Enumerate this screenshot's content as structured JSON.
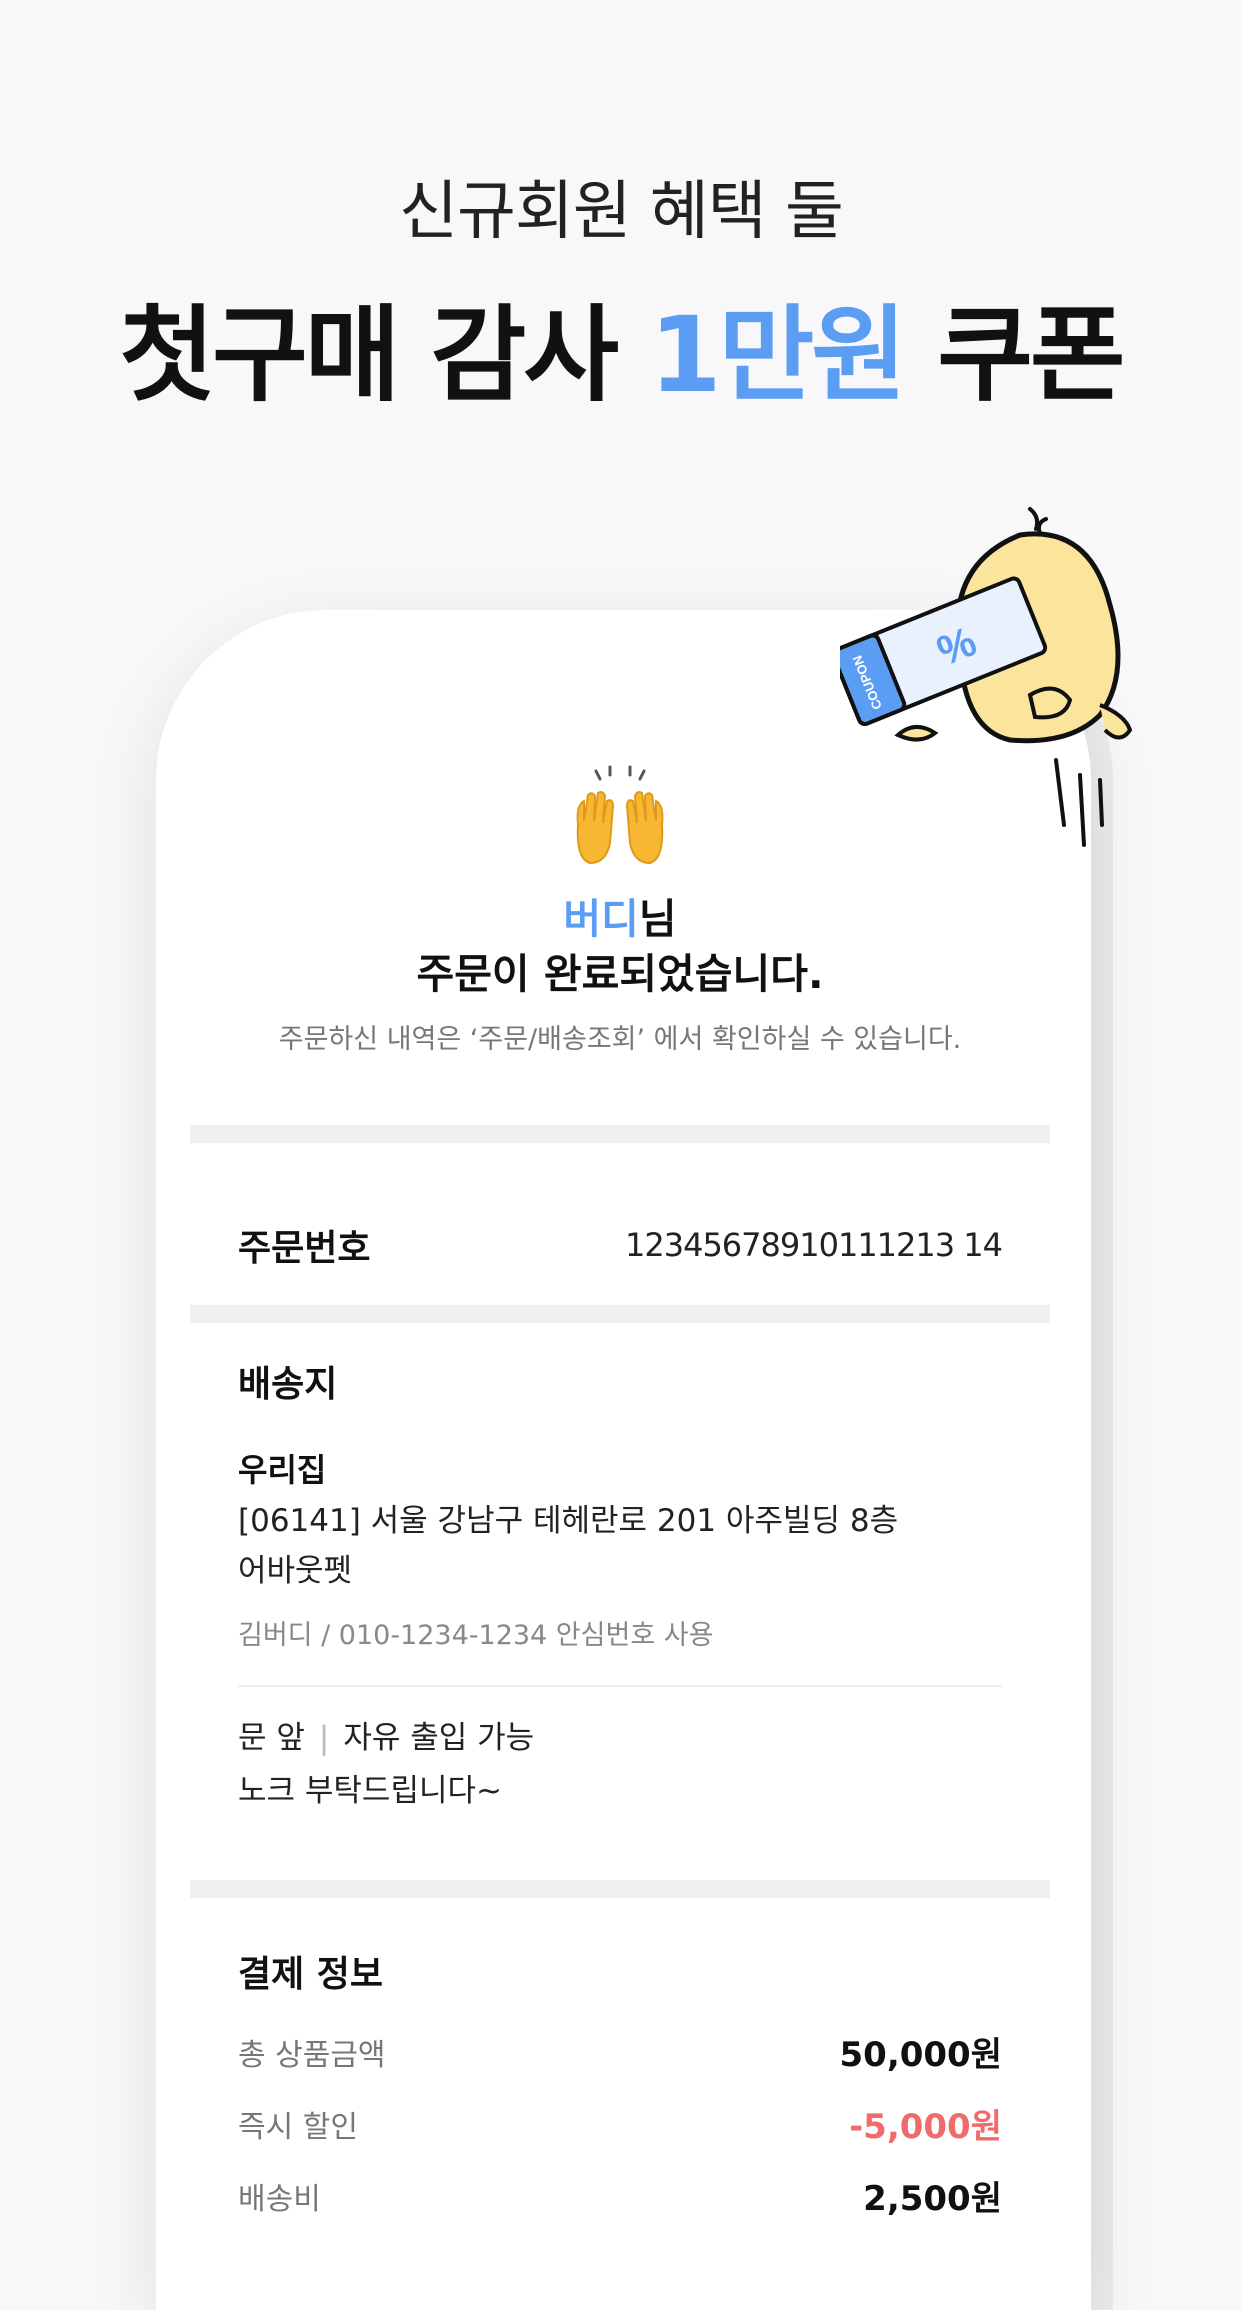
{
  "headline": {
    "sub": "신규회원 혜택 둘",
    "main_prefix": "첫구매 감사 ",
    "main_accent": "1만원",
    "main_suffix": " 쿠폰"
  },
  "colors": {
    "accent": "#5b9df2",
    "discount": "#f06b6b"
  },
  "mascot": {
    "coupon_text": "COUPON",
    "coupon_symbol": "%"
  },
  "order_complete": {
    "name": "버디",
    "name_suffix": "님",
    "title": "주문이 완료되었습니다.",
    "note": "주문하신 내역은 ‘주문/배송조회’ 에서 확인하실 수 있습니다."
  },
  "order": {
    "label": "주문번호",
    "number": "12345678910111213 14"
  },
  "shipping": {
    "title": "배송지",
    "place_name": "우리집",
    "address_line1": "[06141] 서울 강남구 테헤란로 201 아주빌딩 8층",
    "address_line2": "어바웃펫",
    "contact": "김버디 / 010-1234-1234  안심번호 사용",
    "request_location": "문 앞",
    "request_access": "자유 출입 가능",
    "request_message": "노크 부탁드립니다~"
  },
  "payment": {
    "title": "결제 정보",
    "lines": [
      {
        "label": "총 상품금액",
        "value": "50,000원"
      },
      {
        "label": "즉시 할인",
        "value": "-5,000원"
      },
      {
        "label": "배송비",
        "value": "2,500원"
      }
    ]
  }
}
